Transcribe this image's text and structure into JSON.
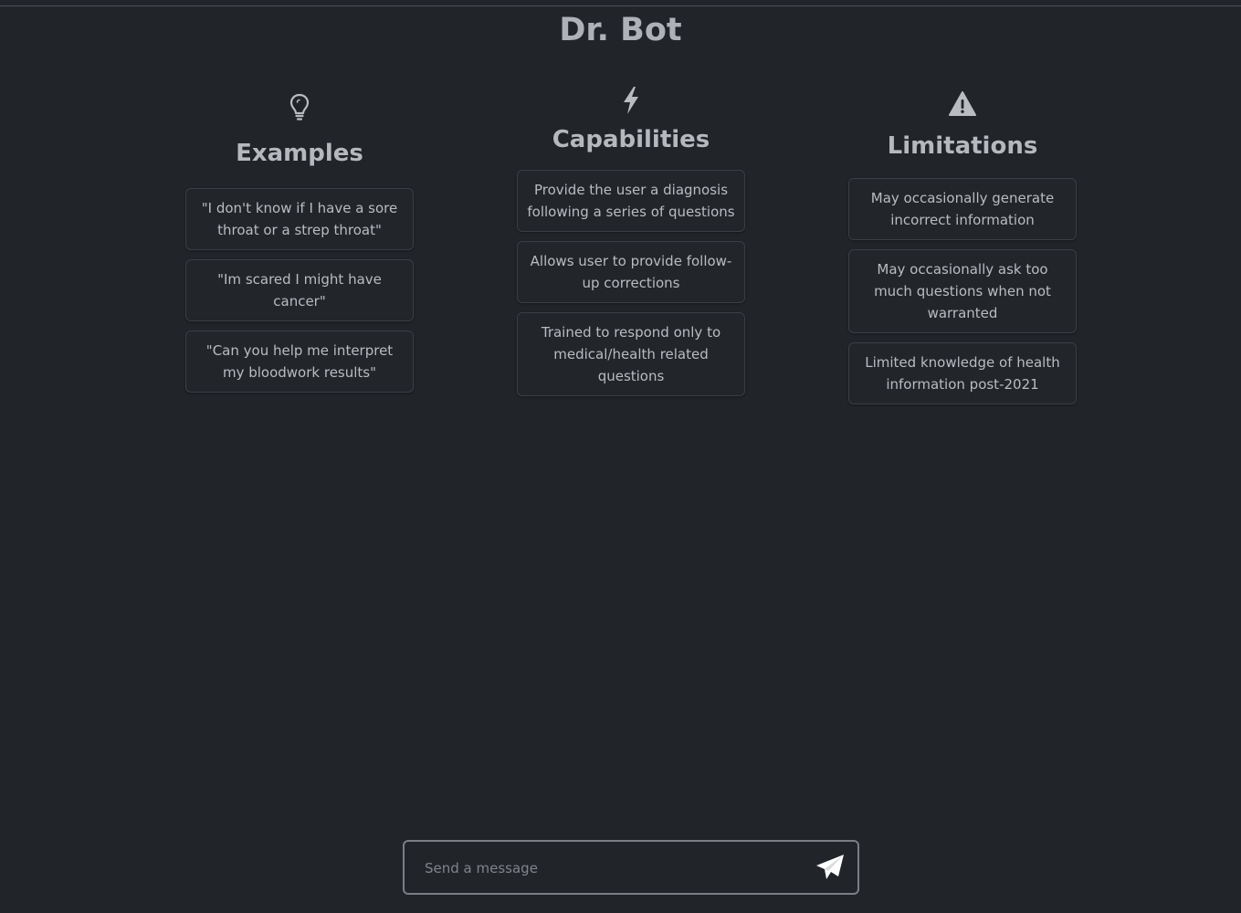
{
  "app": {
    "title": "Dr. Bot"
  },
  "columns": [
    {
      "heading": "Examples",
      "icon": "lightbulb-icon",
      "items": [
        "\"I don't know if I have a sore throat or a strep throat\"",
        "\"Im scared I might have cancer\"",
        "\"Can you help me interpret my bloodwork results\""
      ]
    },
    {
      "heading": "Capabilities",
      "icon": "lightning-icon",
      "items": [
        "Provide the user a diagnosis following a series of questions",
        "Allows user to provide follow-up corrections",
        "Trained to respond only to medical/health related questions"
      ]
    },
    {
      "heading": "Limitations",
      "icon": "warning-icon",
      "items": [
        "May occasionally generate incorrect information",
        "May occasionally ask too much questions when not warranted",
        "Limited knowledge of health information post-2021"
      ]
    }
  ],
  "composer": {
    "placeholder": "Send a message",
    "value": "",
    "send_icon": "paper-plane-icon"
  },
  "colors": {
    "background": "#212429",
    "text": "#b9bcc1",
    "card_border": "#3b3f45",
    "input_border": "#7b7f85"
  }
}
